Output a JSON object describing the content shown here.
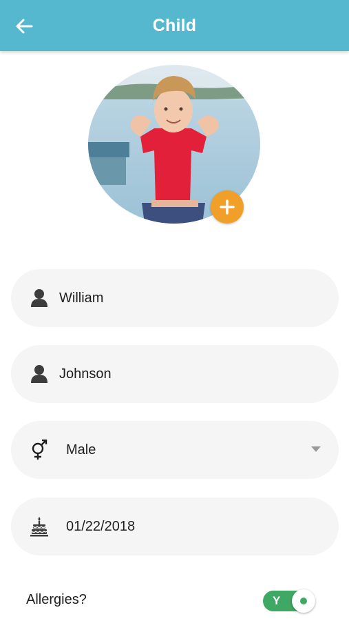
{
  "header": {
    "title": "Child",
    "back_icon": "arrow-left-icon",
    "background_color": "#55b8cf"
  },
  "photo": {
    "add_icon": "plus-icon",
    "accent_color": "#f0a028"
  },
  "form": {
    "first_name": {
      "icon": "person-icon",
      "value": "William"
    },
    "last_name": {
      "icon": "person-icon",
      "value": "Johnson"
    },
    "gender": {
      "icon": "gender-icon",
      "value": "Male",
      "dropdown_icon": "chevron-down-icon"
    },
    "birthdate": {
      "icon": "birthday-cake-icon",
      "value": "01/22/2018"
    }
  },
  "allergies": {
    "label": "Allergies?",
    "toggle_text": "Y",
    "toggle_on": true,
    "toggle_color": "#3ea864"
  }
}
